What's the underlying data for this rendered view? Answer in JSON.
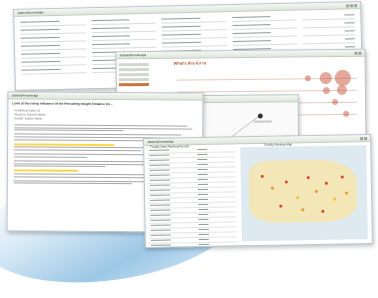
{
  "app": {
    "logo": "Jabber|Knowledge"
  },
  "windows": {
    "w2": {
      "title": "What's this for to"
    },
    "w3": {
      "headline": "Look at the rising influence of the Pervading Insight Initiative (or...",
      "meta": [
        "Published: Date (1)",
        "Sources: Source Name",
        "Author: Author Name"
      ],
      "highlight_term": "Singapore"
    },
    "w5": {
      "table_title": "Facility Data Ranking Results",
      "map_title": "Facility Ranking Map"
    }
  },
  "colors": {
    "accent": "#c8763f",
    "title_red": "#b6482b",
    "highlight": "#f7d94c"
  },
  "icons": [
    "window-control-icon",
    "node-icon"
  ]
}
